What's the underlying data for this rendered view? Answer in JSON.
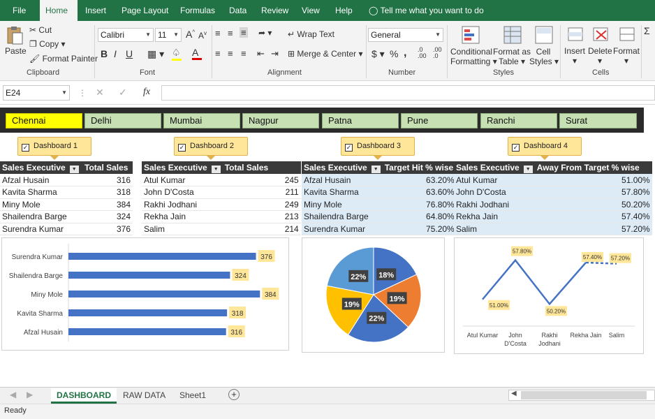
{
  "ribbon_tabs": [
    "File",
    "Home",
    "Insert",
    "Page Layout",
    "Formulas",
    "Data",
    "Review",
    "View",
    "Help"
  ],
  "tell_me": "Tell me what you want to do",
  "clipboard": {
    "paste": "Paste",
    "cut": "Cut",
    "copy": "Copy",
    "format_painter": "Format Painter",
    "group": "Clipboard"
  },
  "font": {
    "name": "Calibri",
    "size": "11",
    "group": "Font",
    "bold": "B",
    "italic": "I",
    "underline": "U",
    "grow": "A",
    "shrink": "A",
    "color_a": "A"
  },
  "alignment": {
    "wrap": "Wrap Text",
    "merge": "Merge & Center",
    "group": "Alignment"
  },
  "number": {
    "format": "General",
    "currency": "$",
    "percent": "%",
    "comma": ",",
    "group": "Number",
    "inc_dec": ".0 .00",
    "dec_dec": ".00 .0"
  },
  "styles": {
    "cond": "Conditional",
    "cond2": "Formatting",
    "fmt_table": "Format as",
    "fmt_table2": "Table",
    "cell_styles": "Cell",
    "cell_styles2": "Styles",
    "group": "Styles"
  },
  "cells": {
    "insert": "Insert",
    "delete": "Delete",
    "format": "Format",
    "group": "Cells"
  },
  "namebox": "E24",
  "fx": "fx",
  "cities": [
    "Chennai",
    "Delhi",
    "Mumbai",
    "Nagpur",
    "Patna",
    "Pune",
    "Ranchi",
    "Surat"
  ],
  "dashboards": [
    "Dashboard 1",
    "Dashboard 2",
    "Dashboard 3",
    "Dashboard 4"
  ],
  "tables": [
    {
      "h1": "Sales Executive",
      "h2": "Total Sales",
      "rows": [
        [
          "Afzal Husain",
          "316"
        ],
        [
          "Kavita Sharma",
          "318"
        ],
        [
          "Miny Mole",
          "384"
        ],
        [
          "Shailendra Barge",
          "324"
        ],
        [
          "Surendra Kumar",
          "376"
        ]
      ]
    },
    {
      "h1": "Sales Executive",
      "h2": "Total Sales",
      "rows": [
        [
          "Atul Kumar",
          "245"
        ],
        [
          "John D'Costa",
          "211"
        ],
        [
          "Rakhi Jodhani",
          "249"
        ],
        [
          "Rekha Jain",
          "213"
        ],
        [
          "Salim",
          "214"
        ]
      ]
    },
    {
      "h1": "Sales Executive",
      "h2": "Target Hit % wise",
      "rows": [
        [
          "Afzal Husain",
          "63.20%"
        ],
        [
          "Kavita Sharma",
          "63.60%"
        ],
        [
          "Miny Mole",
          "76.80%"
        ],
        [
          "Shailendra Barge",
          "64.80%"
        ],
        [
          "Surendra Kumar",
          "75.20%"
        ]
      ]
    },
    {
      "h1": "Sales Executive",
      "h2": "Away From Target % wise",
      "rows": [
        [
          "Atul Kumar",
          "51.00%"
        ],
        [
          "John D'Costa",
          "57.80%"
        ],
        [
          "Rakhi Jodhani",
          "50.20%"
        ],
        [
          "Rekha Jain",
          "57.40%"
        ],
        [
          "Salim",
          "57.20%"
        ]
      ]
    }
  ],
  "chart_data": [
    {
      "type": "bar",
      "orientation": "horizontal",
      "categories": [
        "Surendra Kumar",
        "Shailendra Barge",
        "Miny Mole",
        "Kavita Sharma",
        "Afzal Husain"
      ],
      "values": [
        376,
        324,
        384,
        318,
        316
      ],
      "color": "#4472c4",
      "label_bg": "#ffe699"
    },
    {
      "type": "pie",
      "values": [
        18,
        19,
        22,
        19,
        22
      ],
      "labels": [
        "18%",
        "19%",
        "22%",
        "19%",
        "22%"
      ],
      "colors": [
        "#4472c4",
        "#ed7d31",
        "#4472c4",
        "#ffc000",
        "#5b9bd5"
      ]
    },
    {
      "type": "line",
      "categories": [
        "Atul Kumar",
        "John D'Costa",
        "Rakhi Jodhani",
        "Rekha Jain",
        "Salim"
      ],
      "values": [
        51.0,
        57.8,
        50.2,
        57.4,
        57.2
      ],
      "labels": [
        "51.00%",
        "57.80%",
        "50.20%",
        "57.40%",
        "57.20%"
      ],
      "color": "#4472c4",
      "label_bg": "#ffe699"
    }
  ],
  "sheet_tabs": [
    "DASHBOARD",
    "RAW DATA",
    "Sheet1"
  ],
  "status": "Ready"
}
